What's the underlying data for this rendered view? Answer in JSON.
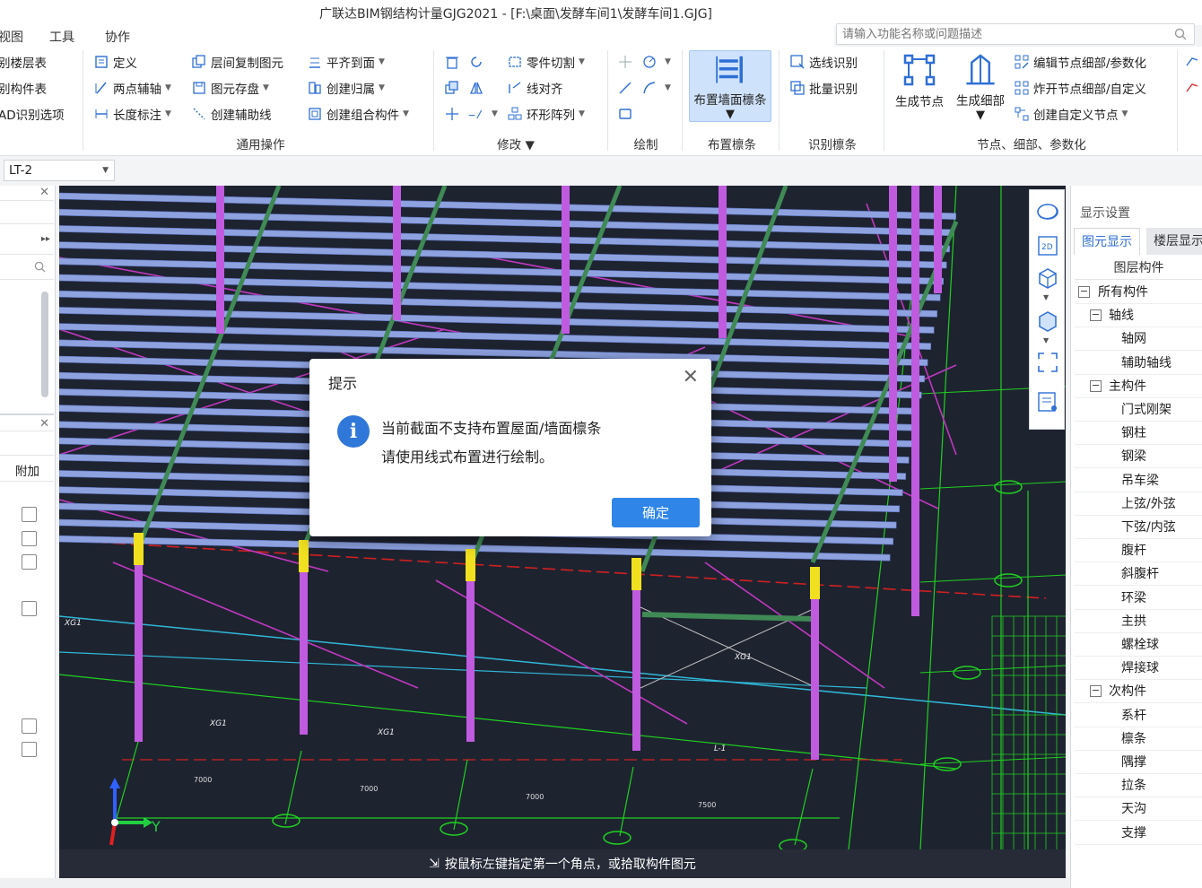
{
  "app": {
    "title": "广联达BIM钢结构计量GJG2021 - [F:\\桌面\\发酵车间1\\发酵车间1.GJG]",
    "search_placeholder": "请输入功能名称或问题描述"
  },
  "menu": {
    "items": [
      "视图",
      "工具",
      "协作"
    ]
  },
  "ribbon": {
    "left_col": [
      "别楼层表",
      "别构件表",
      "AD识别选项"
    ],
    "general": {
      "col1": [
        "定义",
        "两点辅轴",
        "长度标注"
      ],
      "col2": [
        "层间复制图元",
        "图元存盘",
        "创建辅助线"
      ],
      "col3": [
        "平齐到面",
        "创建归属",
        "创建组合构件"
      ],
      "label": "通用操作"
    },
    "modify": {
      "col2": [
        "零件切割",
        "线对齐",
        "环形阵列"
      ],
      "label": "修改"
    },
    "draw": {
      "label": "绘制"
    },
    "place_purlin": {
      "button": "布置墙面檩条",
      "label": "布置檩条"
    },
    "identify_purlin": {
      "items": [
        "选线识别",
        "批量识别"
      ],
      "label": "识别檩条"
    },
    "nodes": {
      "big": [
        "生成节点",
        "生成细部"
      ],
      "items": [
        "编辑节点细部/参数化",
        "炸开节点细部/自定义",
        "创建自定义节点"
      ],
      "label": "节点、细部、参数化"
    }
  },
  "floor_select": {
    "value": "LT-2"
  },
  "left_panel": {
    "column_header": "附加"
  },
  "viewport": {
    "status_text": "按鼠标左键指定第一个角点，或拾取构件图元",
    "axis_label": "Y",
    "dimensions": [
      "7000",
      "7000",
      "7000",
      "7500"
    ],
    "labels": [
      "XG1",
      "XG1",
      "XG1",
      "XG1",
      "L-1"
    ]
  },
  "right_panel": {
    "title": "显示设置",
    "tabs": [
      "图元显示",
      "楼层显示"
    ],
    "header": "图层构件",
    "tree": [
      {
        "label": "所有构件",
        "level": 0,
        "toggle": "−"
      },
      {
        "label": "轴线",
        "level": 1,
        "toggle": "−"
      },
      {
        "label": "轴网",
        "level": 2
      },
      {
        "label": "辅助轴线",
        "level": 2
      },
      {
        "label": "主构件",
        "level": 1,
        "toggle": "−"
      },
      {
        "label": "门式刚架",
        "level": 2
      },
      {
        "label": "钢柱",
        "level": 2
      },
      {
        "label": "钢梁",
        "level": 2
      },
      {
        "label": "吊车梁",
        "level": 2
      },
      {
        "label": "上弦/外弦",
        "level": 2
      },
      {
        "label": "下弦/内弦",
        "level": 2
      },
      {
        "label": "腹杆",
        "level": 2
      },
      {
        "label": "斜腹杆",
        "level": 2
      },
      {
        "label": "环梁",
        "level": 2
      },
      {
        "label": "主拱",
        "level": 2
      },
      {
        "label": "螺栓球",
        "level": 2
      },
      {
        "label": "焊接球",
        "level": 2
      },
      {
        "label": "次构件",
        "level": 1,
        "toggle": "−"
      },
      {
        "label": "系杆",
        "level": 2
      },
      {
        "label": "檩条",
        "level": 2
      },
      {
        "label": "隅撑",
        "level": 2
      },
      {
        "label": "拉条",
        "level": 2
      },
      {
        "label": "天沟",
        "level": 2
      },
      {
        "label": "支撑",
        "level": 2
      }
    ]
  },
  "dialog": {
    "title": "提示",
    "message_line1": "当前截面不支持布置屋面/墙面檩条",
    "message_line2": "请使用线式布置进行绘制。",
    "ok_label": "确定"
  },
  "colors": {
    "viewport_bg": "#1e2330",
    "purlin": "#8ea2e0",
    "column": "#c05be0",
    "rafter": "#3f8a55",
    "bracing": "#c038c0",
    "grid": "#1fd11f",
    "accent": "#2f86e8"
  }
}
